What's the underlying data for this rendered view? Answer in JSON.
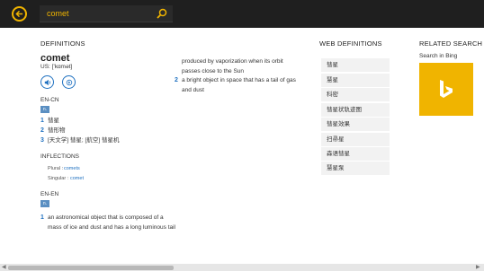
{
  "search": {
    "query": "comet"
  },
  "definitions": {
    "header": "DEFINITIONS",
    "word": "comet",
    "pronunciation": "US: ['kɑmət]",
    "en_cn": {
      "label": "EN-CN",
      "tag": "n.",
      "items": [
        {
          "num": "1",
          "text": "彗星"
        },
        {
          "num": "2",
          "text": "彗形物"
        },
        {
          "num": "3",
          "text": "[天文学] 彗星; [航空] 彗星机"
        }
      ]
    },
    "inflections": {
      "label": "INFLECTIONS",
      "plural_key": "Plural :",
      "plural_value": "comets",
      "singular_key": "Singular :",
      "singular_value": "comet"
    },
    "en_en": {
      "label": "EN-EN",
      "tag": "n.",
      "items": [
        {
          "num": "1",
          "lines": [
            "an astronomical object that is composed of a",
            "mass of ice and dust and has a long luminous tail",
            "produced by vaporization when its orbit",
            "passes close to the Sun"
          ]
        },
        {
          "num": "2",
          "lines": [
            "a bright object in space that has a tail of gas",
            "and dust"
          ]
        }
      ]
    }
  },
  "web_definitions": {
    "header": "WEB DEFINITIONS",
    "items": [
      "彗星",
      "慧星",
      "科密",
      "彗星状轨迹图",
      "彗星效果",
      "扫帚星",
      "森语彗星",
      "慧星泵"
    ]
  },
  "related_search": {
    "header": "RELATED SEARCH",
    "label": "Search in Bing"
  },
  "colors": {
    "accent": "#f0b400",
    "link": "#1e70c0",
    "topbar": "#1f1f1f"
  },
  "icons": [
    "back-arrow-icon",
    "search-icon",
    "speaker-icon",
    "slow-speaker-icon",
    "bing-logo-icon"
  ]
}
